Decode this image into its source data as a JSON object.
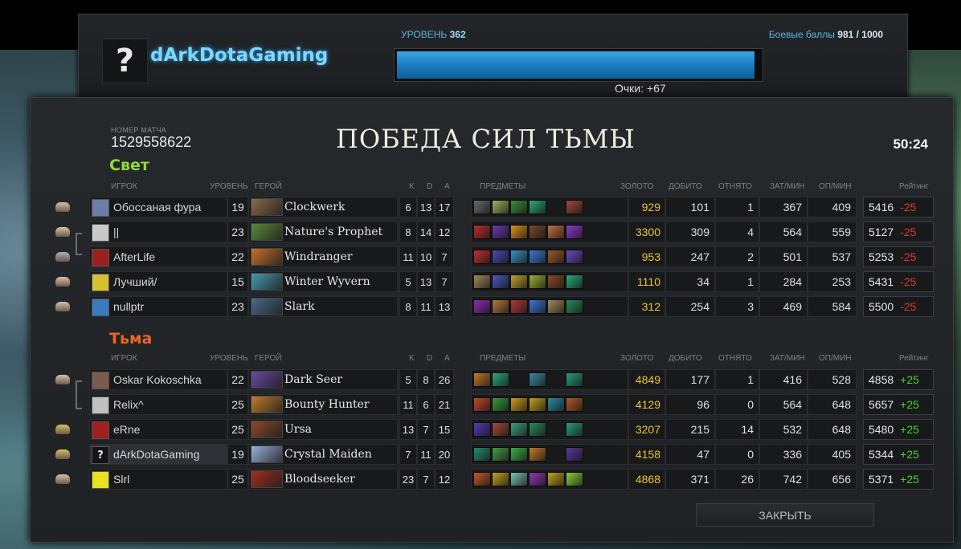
{
  "profile": {
    "name": "dArkDotaGaming",
    "avatar_glyph": "?",
    "level_label": "УРОВЕНЬ",
    "level_value": "362",
    "xp_progress": 0.985,
    "points": "Очки: +67",
    "battle_points_label": "Боевые баллы",
    "battle_points_value": "981 / 1000"
  },
  "match": {
    "id_label": "НОМЕР МАТЧА",
    "id": "1529558622",
    "result": "ПОБЕДА СИЛ ТЬМЫ",
    "duration": "50:24"
  },
  "headers": {
    "player": "ИГРОК",
    "level": "УРОВЕНЬ",
    "hero": "ГЕРОЙ",
    "k": "K",
    "d": "D",
    "a": "A",
    "items": "ПРЕДМЕТЫ",
    "gold": "ЗОЛОТО",
    "last_hits": "ДОБИТО",
    "denies": "ОТНЯТО",
    "gpm": "ЗАТ/МИН",
    "xpm": "ОП/МИН",
    "rating": "Рейтинг"
  },
  "radiant": {
    "title": "Свет",
    "players": [
      {
        "player": "Обоссаная фура",
        "level": "19",
        "hero": "Clockwerk",
        "k": "6",
        "d": "13",
        "a": "17",
        "gold": "929",
        "lh": "101",
        "dn": "1",
        "gpm": "367",
        "xpm": "409",
        "rating": "5416",
        "delta": "-25",
        "player_color": "#6a7ea8",
        "hero_color": "#8a6a4a",
        "items": [
          "#6a6a6a",
          "#a0b060",
          "#3c8c3c",
          "#2aa87a",
          "",
          "#9a4a3a"
        ],
        "medal": "#d8c0a8"
      },
      {
        "player": "||",
        "level": "23",
        "hero": "Nature's Prophet",
        "k": "8",
        "d": "14",
        "a": "12",
        "gold": "3300",
        "lh": "309",
        "dn": "4",
        "gpm": "564",
        "xpm": "559",
        "rating": "5127",
        "delta": "-25",
        "player_color": "#c8c8c8",
        "hero_color": "#5a8a3a",
        "items": [
          "#b83030",
          "#6a3ab0",
          "#e09020",
          "#7a4a2a",
          "#c07040",
          "#8a3ad0"
        ],
        "medal": "#d8c0a8"
      },
      {
        "player": "AfterLife",
        "level": "22",
        "hero": "Windranger",
        "k": "11",
        "d": "10",
        "a": "7",
        "gold": "953",
        "lh": "247",
        "dn": "2",
        "gpm": "501",
        "xpm": "537",
        "rating": "5253",
        "delta": "-25",
        "player_color": "#9a2020",
        "hero_color": "#c8702a",
        "items": [
          "#c03030",
          "#4a4ab0",
          "#3a90c0",
          "#3a7ad0",
          "#9a5a2a",
          "#6a4ac0"
        ],
        "medal": "#a8b0b8"
      },
      {
        "player": "Лучший/",
        "level": "15",
        "hero": "Winter Wyvern",
        "k": "5",
        "d": "13",
        "a": "7",
        "gold": "1110",
        "lh": "34",
        "dn": "1",
        "gpm": "284",
        "xpm": "253",
        "rating": "5431",
        "delta": "-25",
        "player_color": "#d8c030",
        "hero_color": "#4a9ab0",
        "items": [
          "#a08a5a",
          "#4a5ac0",
          "#c0a030",
          "#9ab030",
          "#8a4a2a",
          "#2aa87a"
        ],
        "medal": "#d8c0a8"
      },
      {
        "player": "nullptr",
        "level": "23",
        "hero": "Slark",
        "k": "8",
        "d": "11",
        "a": "13",
        "gold": "312",
        "lh": "254",
        "dn": "3",
        "gpm": "469",
        "xpm": "584",
        "rating": "5500",
        "delta": "-25",
        "player_color": "#3a7ac0",
        "hero_color": "#4a6a8a",
        "items": [
          "#8a30b0",
          "#b07a3a",
          "#b03a3a",
          "#3a7ad0",
          "#a08a5a",
          "#2a8a5a"
        ],
        "medal": "#d8c0a8"
      }
    ]
  },
  "dire": {
    "title": "Тьма",
    "players": [
      {
        "player": "Oskar Kokoschka",
        "level": "22",
        "hero": "Dark Seer",
        "k": "5",
        "d": "8",
        "a": "26",
        "gold": "4849",
        "lh": "177",
        "dn": "1",
        "gpm": "416",
        "xpm": "528",
        "rating": "4858",
        "delta": "+25",
        "player_color": "#7a5a4a",
        "hero_color": "#6a4aa0",
        "items": [
          "#c07a2a",
          "#2aa87a",
          "",
          "#3a8aa0",
          "",
          "#2a9a7a"
        ],
        "medal": "#d8c0a8"
      },
      {
        "player": "Relix^",
        "level": "25",
        "hero": "Bounty Hunter",
        "k": "11",
        "d": "6",
        "a": "21",
        "gold": "4129",
        "lh": "96",
        "dn": "0",
        "gpm": "564",
        "xpm": "648",
        "rating": "5657",
        "delta": "+25",
        "player_color": "#c0c0c0",
        "hero_color": "#c07a2a",
        "items": [
          "#c04a2a",
          "#3a9a3a",
          "#d09a20",
          "#c0a020",
          "#2a8aa0",
          "#b05a2a"
        ],
        "medal": ""
      },
      {
        "player": "eRne",
        "level": "25",
        "hero": "Ursa",
        "k": "13",
        "d": "7",
        "a": "15",
        "gold": "3207",
        "lh": "215",
        "dn": "14",
        "gpm": "532",
        "xpm": "648",
        "rating": "5480",
        "delta": "+25",
        "player_color": "#a02020",
        "hero_color": "#8a4a2a",
        "items": [
          "#5a3ab0",
          "#a04a3a",
          "#3aa07a",
          "#2a8a5a",
          "",
          "#2a9a7a"
        ],
        "medal": "#d8c060"
      },
      {
        "player": "dArkDotaGaming",
        "level": "19",
        "hero": "Crystal Maiden",
        "k": "7",
        "d": "11",
        "a": "20",
        "gold": "4158",
        "lh": "47",
        "dn": "0",
        "gpm": "336",
        "xpm": "405",
        "rating": "5344",
        "delta": "+25",
        "player_color": "#141517",
        "hero_color": "#9ab0d8",
        "items": [
          "#2a8a6a",
          "#4a9a4a",
          "#3ab04a",
          "#c07a2a",
          "",
          "#5a3a9a"
        ],
        "medal": "#d8c060",
        "self": true
      },
      {
        "player": "Slrl",
        "level": "25",
        "hero": "Bloodseeker",
        "k": "23",
        "d": "7",
        "a": "12",
        "gold": "4868",
        "lh": "371",
        "dn": "26",
        "gpm": "742",
        "xpm": "656",
        "rating": "5371",
        "delta": "+25",
        "player_color": "#e8e020",
        "hero_color": "#a03020",
        "items": [
          "#c05a2a",
          "#c0a020",
          "#7ac0b0",
          "#8a3ab0",
          "#c0a020",
          "#8ad03a"
        ],
        "medal": "#d8c0a8"
      }
    ]
  },
  "close_label": "ЗАКРЫТЬ",
  "self_avatar_glyph": "?"
}
